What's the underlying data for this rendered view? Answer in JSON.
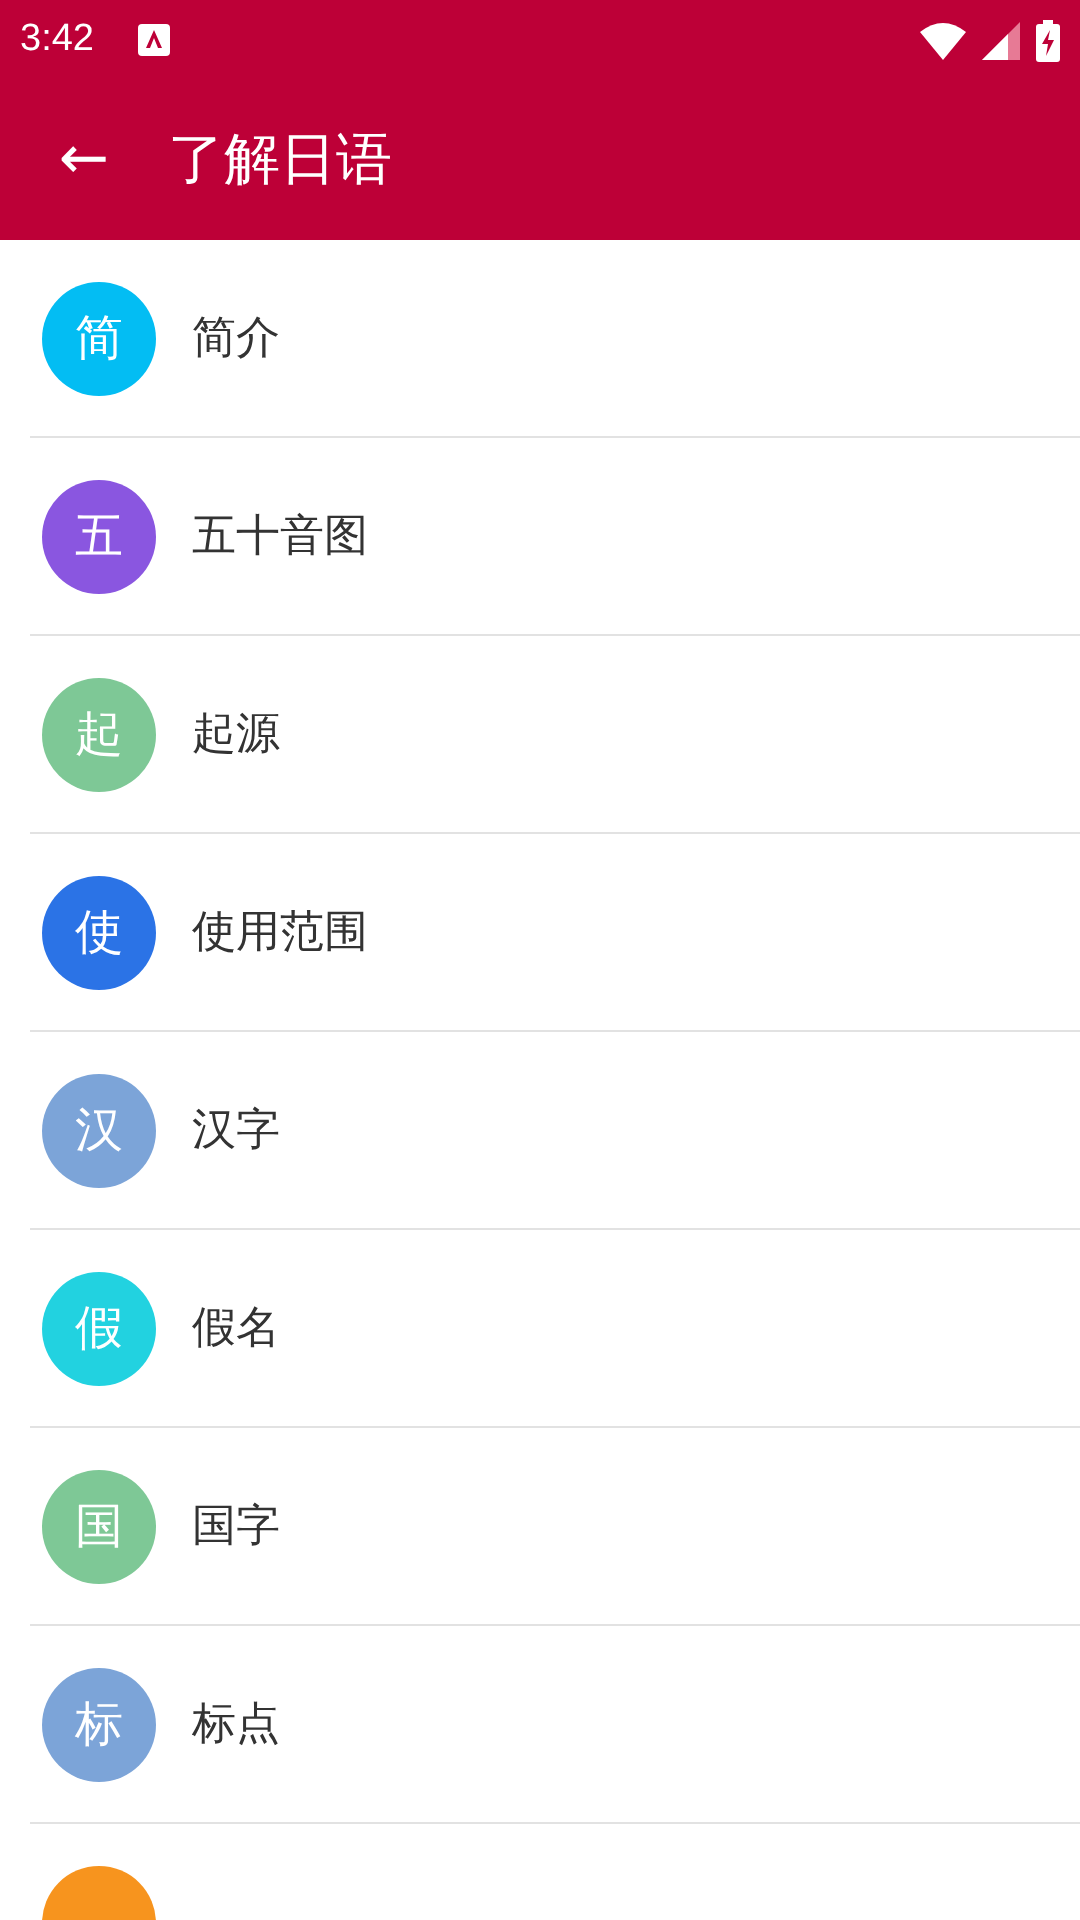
{
  "status_bar": {
    "time": "3:42"
  },
  "app_bar": {
    "back": "←",
    "title": "了解日语"
  },
  "items": [
    {
      "initial": "简",
      "label": "简介",
      "color": "#03bdf3"
    },
    {
      "initial": "五",
      "label": "五十音图",
      "color": "#8a56e0"
    },
    {
      "initial": "起",
      "label": "起源",
      "color": "#7ec896"
    },
    {
      "initial": "使",
      "label": "使用范围",
      "color": "#2b73e6"
    },
    {
      "initial": "汉",
      "label": "汉字",
      "color": "#7ca4d8"
    },
    {
      "initial": "假",
      "label": "假名",
      "color": "#22d2e0"
    },
    {
      "initial": "国",
      "label": "国字",
      "color": "#7ec896"
    },
    {
      "initial": "标",
      "label": "标点",
      "color": "#7ca4d8"
    },
    {
      "color": "#f7941e"
    }
  ]
}
